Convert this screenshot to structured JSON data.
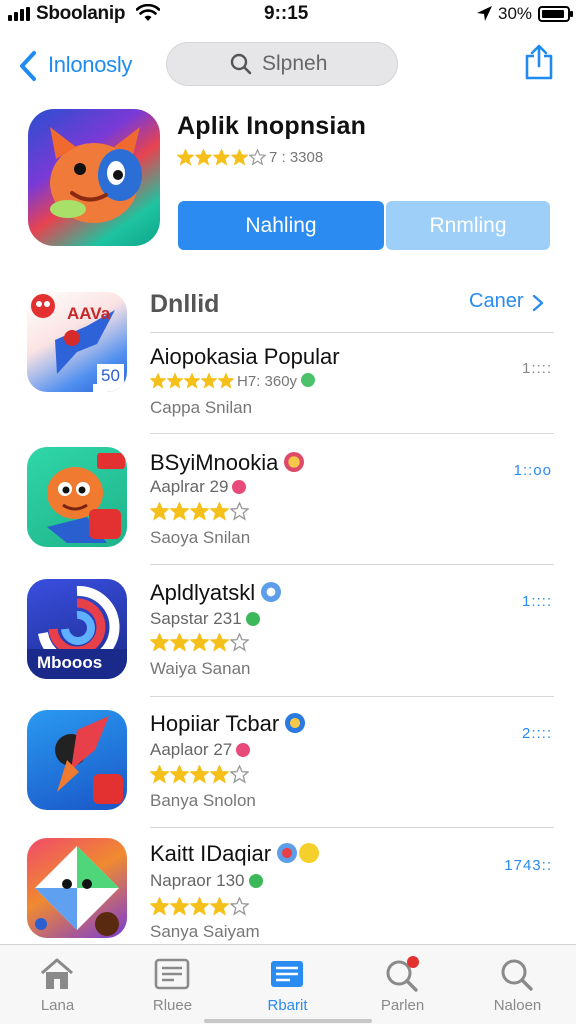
{
  "status_bar": {
    "carrier": "Sboolanip",
    "time": "9::15",
    "battery_text": "30%",
    "battery_level": 0.9
  },
  "nav": {
    "back_label": "Inlonosly",
    "search_label": "Slpneh"
  },
  "hero": {
    "title": "Aplik Inopnsian",
    "rating_text": "7 : 3308",
    "stars": 4,
    "button_primary": "Nahling",
    "button_secondary": "Rnmling"
  },
  "section": {
    "heading": "Dnllid",
    "link": "Caner"
  },
  "apps": [
    {
      "name": "Aiopokasia Popular",
      "rating_text": "H7: 360y",
      "sub": "",
      "meta": "Cappa Snilan",
      "right": "1::::",
      "stars": 5,
      "icon_label": "AAVa",
      "icon_badge": "50"
    },
    {
      "name": "BSyiMnookia",
      "sub": "Aaplrar 29",
      "rating_text": "",
      "meta": "Saoya Snilan",
      "right": "1::oo",
      "stars": 4,
      "icon_label": "",
      "icon_badge": ""
    },
    {
      "name": "Apldlyatskl",
      "sub": "Sapstar 231",
      "rating_text": "",
      "meta": "Waiya Sanan",
      "right": "1::::",
      "stars": 4,
      "icon_label": "Mbooos",
      "icon_badge": ""
    },
    {
      "name": "Hopiiar Tcbar",
      "sub": "Aaplaor 27",
      "rating_text": "",
      "meta": "Banya Snolon",
      "right": "2::::",
      "stars": 4,
      "icon_label": "",
      "icon_badge": ""
    },
    {
      "name": "Kaitt IDaqiar",
      "sub": "Napraor 130",
      "rating_text": "",
      "meta": "Sanya Saiyam",
      "right": "1743::",
      "stars": 4,
      "icon_label": "",
      "icon_badge": ""
    }
  ],
  "tabs": [
    {
      "label": "Lana",
      "icon": "home-icon",
      "active": false
    },
    {
      "label": "Rluee",
      "icon": "news-icon",
      "active": false
    },
    {
      "label": "Rbarit",
      "icon": "apps-icon",
      "active": true
    },
    {
      "label": "Parlen",
      "icon": "search-badge-icon",
      "active": false
    },
    {
      "label": "Naloen",
      "icon": "search-icon",
      "active": false
    }
  ],
  "colors": {
    "accent": "#2a8bf0",
    "star": "#f5c01a",
    "button_primary": "#2c8bf0",
    "button_secondary": "#9dcff8"
  }
}
